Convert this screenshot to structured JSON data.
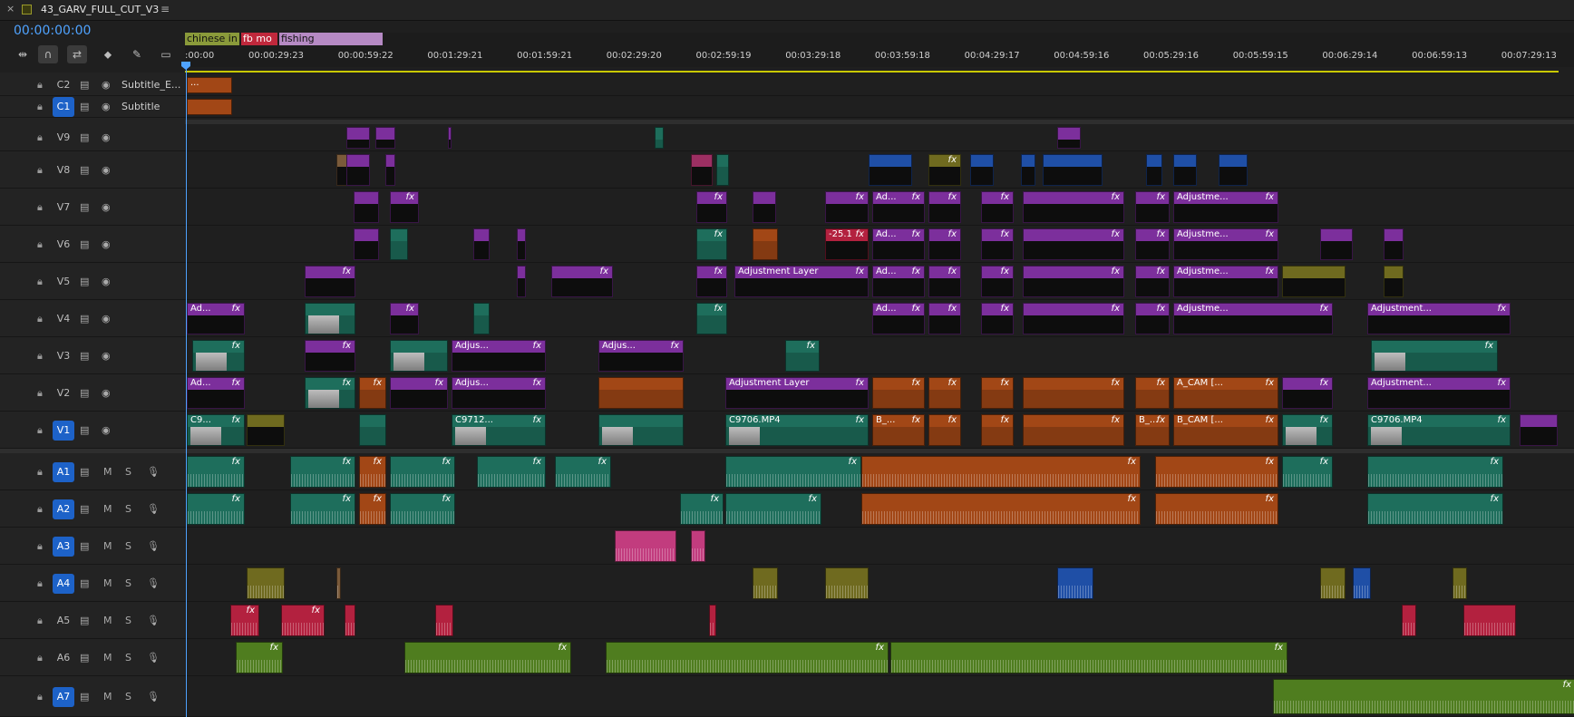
{
  "window": {
    "title": "43_GARV_FULL_CUT_V3",
    "close_icon": "close-icon",
    "menu_icon": "hamburger-menu-icon"
  },
  "timecode": "00:00:00:00",
  "tools": [
    "insert-overwrite-icon",
    "snap-magnet-icon",
    "linked-selection-icon",
    "add-marker-icon",
    "wrench-settings-icon",
    "captions-icon"
  ],
  "markers": [
    {
      "label": "chinese in",
      "color": "#8a9a3a"
    },
    {
      "label": "fb mo",
      "color": "#c0283c"
    },
    {
      "label": "fishing",
      "color": "#b68ac4"
    }
  ],
  "ruler_ticks": [
    ":00:00",
    "00:00:29:23",
    "00:00:59:22",
    "00:01:29:21",
    "00:01:59:21",
    "00:02:29:20",
    "00:02:59:19",
    "00:03:29:18",
    "00:03:59:18",
    "00:04:29:17",
    "00:04:59:16",
    "00:05:29:16",
    "00:05:59:15",
    "00:06:29:14",
    "00:06:59:13",
    "00:07:29:13"
  ],
  "subtitle_tracks": [
    {
      "name": "C2",
      "label": "Subtitle_E...",
      "active": false
    },
    {
      "name": "C1",
      "label": "Subtitle",
      "active": true
    }
  ],
  "video_tracks": [
    {
      "name": "V9",
      "active": false
    },
    {
      "name": "V8",
      "active": false
    },
    {
      "name": "V7",
      "active": false
    },
    {
      "name": "V6",
      "active": false
    },
    {
      "name": "V5",
      "active": false
    },
    {
      "name": "V4",
      "active": false
    },
    {
      "name": "V3",
      "active": false
    },
    {
      "name": "V2",
      "active": false
    },
    {
      "name": "V1",
      "active": true
    }
  ],
  "audio_tracks": [
    {
      "name": "A1",
      "active": true,
      "m": "M",
      "s": "S"
    },
    {
      "name": "A2",
      "active": true,
      "m": "M",
      "s": "S"
    },
    {
      "name": "A3",
      "active": true,
      "m": "M",
      "s": "S"
    },
    {
      "name": "A4",
      "active": true,
      "m": "M",
      "s": "S"
    },
    {
      "name": "A5",
      "active": false,
      "m": "M",
      "s": "S"
    },
    {
      "name": "A6",
      "active": false,
      "m": "M",
      "s": "S"
    },
    {
      "name": "A7",
      "active": true,
      "m": "M",
      "s": "S"
    }
  ],
  "clips": {
    "C2": [
      {
        "c": "orange",
        "s": 0,
        "e": 50,
        "l": "..."
      }
    ],
    "C1": [
      {
        "c": "orange",
        "s": 0,
        "e": 50,
        "l": ""
      }
    ],
    "V9": [
      {
        "c": "purple",
        "s": 176,
        "e": 202,
        "l": ""
      },
      {
        "c": "purple",
        "s": 208,
        "e": 230,
        "l": ""
      },
      {
        "c": "purple",
        "s": 288,
        "e": 292,
        "l": ""
      },
      {
        "c": "teal",
        "s": 516,
        "e": 526,
        "l": ""
      },
      {
        "c": "purple",
        "s": 960,
        "e": 986,
        "l": ""
      }
    ],
    "V8": [
      {
        "c": "tan",
        "s": 165,
        "e": 180,
        "l": ""
      },
      {
        "c": "purple",
        "s": 176,
        "e": 202,
        "l": ""
      },
      {
        "c": "purple",
        "s": 219,
        "e": 230,
        "l": ""
      },
      {
        "c": "magenta",
        "s": 556,
        "e": 580,
        "l": ""
      },
      {
        "c": "teal",
        "s": 584,
        "e": 598,
        "l": ""
      },
      {
        "c": "blue",
        "s": 752,
        "e": 800,
        "l": ""
      },
      {
        "c": "olive",
        "s": 818,
        "e": 854,
        "l": "fx"
      },
      {
        "c": "blue",
        "s": 864,
        "e": 890,
        "l": ""
      },
      {
        "c": "blue",
        "s": 920,
        "e": 936,
        "l": ""
      },
      {
        "c": "blue",
        "s": 944,
        "e": 1010,
        "l": ""
      },
      {
        "c": "blue",
        "s": 1058,
        "e": 1076,
        "l": ""
      },
      {
        "c": "blue",
        "s": 1088,
        "e": 1114,
        "l": ""
      },
      {
        "c": "blue",
        "s": 1138,
        "e": 1170,
        "l": ""
      }
    ],
    "V7": [
      {
        "c": "purple",
        "s": 184,
        "e": 212,
        "l": ""
      },
      {
        "c": "purple",
        "s": 224,
        "e": 256,
        "l": "fx"
      },
      {
        "c": "purple",
        "s": 562,
        "e": 596,
        "l": "fx"
      },
      {
        "c": "purple",
        "s": 624,
        "e": 650,
        "l": ""
      },
      {
        "c": "purple",
        "s": 704,
        "e": 752,
        "l": "fx"
      },
      {
        "c": "purple",
        "s": 756,
        "e": 814,
        "l": "Ad..."
      },
      {
        "c": "purple",
        "s": 818,
        "e": 854,
        "l": "fx"
      },
      {
        "c": "purple",
        "s": 876,
        "e": 912,
        "l": "fx"
      },
      {
        "c": "purple",
        "s": 922,
        "e": 1034,
        "l": "fx"
      },
      {
        "c": "purple",
        "s": 1046,
        "e": 1084,
        "l": "fx"
      },
      {
        "c": "purple",
        "s": 1088,
        "e": 1204,
        "l": "Adjustme..."
      }
    ],
    "V6": [
      {
        "c": "purple",
        "s": 184,
        "e": 212,
        "l": ""
      },
      {
        "c": "teal",
        "s": 224,
        "e": 244,
        "l": ""
      },
      {
        "c": "purple",
        "s": 316,
        "e": 334,
        "l": ""
      },
      {
        "c": "purple",
        "s": 364,
        "e": 374,
        "l": ""
      },
      {
        "c": "teal",
        "s": 562,
        "e": 596,
        "l": "fx"
      },
      {
        "c": "orange",
        "s": 624,
        "e": 652,
        "l": ""
      },
      {
        "c": "red",
        "s": 704,
        "e": 752,
        "l": "-25.1"
      },
      {
        "c": "purple",
        "s": 756,
        "e": 814,
        "l": "Ad..."
      },
      {
        "c": "purple",
        "s": 818,
        "e": 854,
        "l": "fx"
      },
      {
        "c": "purple",
        "s": 876,
        "e": 912,
        "l": "fx"
      },
      {
        "c": "purple",
        "s": 922,
        "e": 1034,
        "l": "fx"
      },
      {
        "c": "purple",
        "s": 1046,
        "e": 1084,
        "l": "fx"
      },
      {
        "c": "purple",
        "s": 1088,
        "e": 1204,
        "l": "Adjustme..."
      },
      {
        "c": "purple",
        "s": 1250,
        "e": 1286,
        "l": ""
      },
      {
        "c": "purple",
        "s": 1320,
        "e": 1342,
        "l": ""
      }
    ],
    "V5": [
      {
        "c": "purple",
        "s": 130,
        "e": 186,
        "l": "fx"
      },
      {
        "c": "purple",
        "s": 364,
        "e": 374,
        "l": ""
      },
      {
        "c": "purple",
        "s": 402,
        "e": 470,
        "l": "fx"
      },
      {
        "c": "purple",
        "s": 562,
        "e": 596,
        "l": "fx"
      },
      {
        "c": "purple",
        "s": 604,
        "e": 752,
        "l": "Adjustment Layer"
      },
      {
        "c": "purple",
        "s": 756,
        "e": 814,
        "l": "Ad..."
      },
      {
        "c": "purple",
        "s": 818,
        "e": 854,
        "l": "fx"
      },
      {
        "c": "purple",
        "s": 876,
        "e": 912,
        "l": "fx"
      },
      {
        "c": "purple",
        "s": 922,
        "e": 1034,
        "l": "fx"
      },
      {
        "c": "purple",
        "s": 1046,
        "e": 1084,
        "l": "fx"
      },
      {
        "c": "purple",
        "s": 1088,
        "e": 1204,
        "l": "Adjustme..."
      },
      {
        "c": "olive",
        "s": 1208,
        "e": 1278,
        "l": ""
      },
      {
        "c": "olive",
        "s": 1320,
        "e": 1342,
        "l": ""
      }
    ],
    "V4": [
      {
        "c": "purple",
        "s": 0,
        "e": 64,
        "l": "Ad..."
      },
      {
        "c": "teal",
        "s": 130,
        "e": 186,
        "l": ""
      },
      {
        "c": "purple",
        "s": 224,
        "e": 256,
        "l": "fx"
      },
      {
        "c": "teal",
        "s": 316,
        "e": 334,
        "l": ""
      },
      {
        "c": "teal",
        "s": 562,
        "e": 596,
        "l": "fx"
      },
      {
        "c": "purple",
        "s": 756,
        "e": 814,
        "l": "Ad..."
      },
      {
        "c": "purple",
        "s": 818,
        "e": 854,
        "l": "fx"
      },
      {
        "c": "purple",
        "s": 876,
        "e": 912,
        "l": "fx"
      },
      {
        "c": "purple",
        "s": 922,
        "e": 1034,
        "l": "fx"
      },
      {
        "c": "purple",
        "s": 1046,
        "e": 1084,
        "l": "fx"
      },
      {
        "c": "purple",
        "s": 1088,
        "e": 1264,
        "l": "Adjustme..."
      },
      {
        "c": "purple",
        "s": 1302,
        "e": 1460,
        "l": "Adjustment..."
      }
    ],
    "V3": [
      {
        "c": "teal",
        "s": 6,
        "e": 64,
        "l": "fx"
      },
      {
        "c": "purple",
        "s": 130,
        "e": 186,
        "l": "fx"
      },
      {
        "c": "teal",
        "s": 224,
        "e": 288,
        "l": ""
      },
      {
        "c": "purple",
        "s": 292,
        "e": 396,
        "l": "Adjus..."
      },
      {
        "c": "purple",
        "s": 454,
        "e": 548,
        "l": "Adjus..."
      },
      {
        "c": "teal",
        "s": 660,
        "e": 698,
        "l": "fx"
      },
      {
        "c": "teal",
        "s": 1306,
        "e": 1446,
        "l": "fx"
      }
    ],
    "V2": [
      {
        "c": "purple",
        "s": 0,
        "e": 64,
        "l": "Ad..."
      },
      {
        "c": "teal",
        "s": 130,
        "e": 186,
        "l": "fx"
      },
      {
        "c": "orange",
        "s": 190,
        "e": 220,
        "l": "fx"
      },
      {
        "c": "purple",
        "s": 224,
        "e": 288,
        "l": "fx"
      },
      {
        "c": "purple",
        "s": 292,
        "e": 396,
        "l": "Adjus..."
      },
      {
        "c": "orange",
        "s": 454,
        "e": 548,
        "l": ""
      },
      {
        "c": "purple",
        "s": 594,
        "e": 752,
        "l": "Adjustment Layer"
      },
      {
        "c": "orange",
        "s": 756,
        "e": 814,
        "l": "fx"
      },
      {
        "c": "orange",
        "s": 818,
        "e": 854,
        "l": "fx"
      },
      {
        "c": "orange",
        "s": 876,
        "e": 912,
        "l": "fx"
      },
      {
        "c": "orange",
        "s": 922,
        "e": 1034,
        "l": "fx"
      },
      {
        "c": "orange",
        "s": 1046,
        "e": 1084,
        "l": "fx"
      },
      {
        "c": "orange",
        "s": 1088,
        "e": 1204,
        "l": "A_CAM [..."
      },
      {
        "c": "purple",
        "s": 1208,
        "e": 1264,
        "l": "fx"
      },
      {
        "c": "purple",
        "s": 1302,
        "e": 1460,
        "l": "Adjustment..."
      }
    ],
    "V1": [
      {
        "c": "teal",
        "s": 0,
        "e": 64,
        "l": "C9..."
      },
      {
        "c": "olive",
        "s": 66,
        "e": 108,
        "l": ""
      },
      {
        "c": "teal",
        "s": 190,
        "e": 220,
        "l": ""
      },
      {
        "c": "teal",
        "s": 292,
        "e": 396,
        "l": "C9712..."
      },
      {
        "c": "teal",
        "s": 454,
        "e": 548,
        "l": ""
      },
      {
        "c": "teal",
        "s": 594,
        "e": 752,
        "l": "C9706.MP4"
      },
      {
        "c": "orange",
        "s": 756,
        "e": 814,
        "l": "B_..."
      },
      {
        "c": "orange",
        "s": 818,
        "e": 854,
        "l": "fx"
      },
      {
        "c": "orange",
        "s": 876,
        "e": 912,
        "l": "fx"
      },
      {
        "c": "orange",
        "s": 922,
        "e": 1034,
        "l": "fx"
      },
      {
        "c": "orange",
        "s": 1046,
        "e": 1084,
        "l": "B_..."
      },
      {
        "c": "orange",
        "s": 1088,
        "e": 1204,
        "l": "B_CAM [..."
      },
      {
        "c": "teal",
        "s": 1208,
        "e": 1264,
        "l": "fx"
      },
      {
        "c": "teal",
        "s": 1302,
        "e": 1460,
        "l": "C9706.MP4"
      },
      {
        "c": "purple",
        "s": 1470,
        "e": 1512,
        "l": ""
      }
    ],
    "A1": [
      {
        "c": "teal",
        "s": 0,
        "e": 64,
        "l": "fx"
      },
      {
        "c": "teal",
        "s": 114,
        "e": 186,
        "l": "fx"
      },
      {
        "c": "orange",
        "s": 190,
        "e": 220,
        "l": "fx"
      },
      {
        "c": "teal",
        "s": 224,
        "e": 296,
        "l": "fx"
      },
      {
        "c": "teal",
        "s": 320,
        "e": 396,
        "l": "fx"
      },
      {
        "c": "teal",
        "s": 406,
        "e": 468,
        "l": "fx"
      },
      {
        "c": "teal",
        "s": 594,
        "e": 744,
        "l": "fx"
      },
      {
        "c": "orange",
        "s": 744,
        "e": 1052,
        "l": "fx"
      },
      {
        "c": "orange",
        "s": 1068,
        "e": 1204,
        "l": "fx"
      },
      {
        "c": "teal",
        "s": 1208,
        "e": 1264,
        "l": "fx"
      },
      {
        "c": "teal",
        "s": 1302,
        "e": 1452,
        "l": "fx"
      }
    ],
    "A2": [
      {
        "c": "teal",
        "s": 0,
        "e": 64,
        "l": "fx"
      },
      {
        "c": "teal",
        "s": 114,
        "e": 186,
        "l": "fx"
      },
      {
        "c": "orange",
        "s": 190,
        "e": 220,
        "l": "fx"
      },
      {
        "c": "teal",
        "s": 224,
        "e": 296,
        "l": "fx"
      },
      {
        "c": "teal",
        "s": 544,
        "e": 592,
        "l": "fx"
      },
      {
        "c": "teal",
        "s": 594,
        "e": 700,
        "l": "fx"
      },
      {
        "c": "orange",
        "s": 744,
        "e": 1052,
        "l": "fx"
      },
      {
        "c": "orange",
        "s": 1068,
        "e": 1204,
        "l": "fx"
      },
      {
        "c": "teal",
        "s": 1302,
        "e": 1452,
        "l": "fx"
      }
    ],
    "A3": [
      {
        "c": "pink",
        "s": 472,
        "e": 540,
        "l": ""
      },
      {
        "c": "pink",
        "s": 556,
        "e": 572,
        "l": ""
      }
    ],
    "A4": [
      {
        "c": "olive",
        "s": 66,
        "e": 108,
        "l": ""
      },
      {
        "c": "tan",
        "s": 165,
        "e": 170,
        "l": ""
      },
      {
        "c": "olive",
        "s": 624,
        "e": 652,
        "l": ""
      },
      {
        "c": "olive",
        "s": 704,
        "e": 752,
        "l": ""
      },
      {
        "c": "blue",
        "s": 960,
        "e": 1000,
        "l": ""
      },
      {
        "c": "olive",
        "s": 1250,
        "e": 1278,
        "l": ""
      },
      {
        "c": "blue",
        "s": 1286,
        "e": 1306,
        "l": ""
      },
      {
        "c": "olive",
        "s": 1396,
        "e": 1412,
        "l": ""
      }
    ],
    "A5": [
      {
        "c": "red",
        "s": 48,
        "e": 80,
        "l": "fx"
      },
      {
        "c": "red",
        "s": 104,
        "e": 152,
        "l": "fx"
      },
      {
        "c": "red",
        "s": 174,
        "e": 186,
        "l": ""
      },
      {
        "c": "red",
        "s": 274,
        "e": 294,
        "l": ""
      },
      {
        "c": "red",
        "s": 576,
        "e": 584,
        "l": ""
      },
      {
        "c": "red",
        "s": 1340,
        "e": 1356,
        "l": ""
      },
      {
        "c": "red",
        "s": 1408,
        "e": 1466,
        "l": ""
      }
    ],
    "A6": [
      {
        "c": "green",
        "s": 54,
        "e": 106,
        "l": "fx"
      },
      {
        "c": "green",
        "s": 240,
        "e": 424,
        "l": "fx"
      },
      {
        "c": "green",
        "s": 462,
        "e": 774,
        "l": "fx"
      },
      {
        "c": "green",
        "s": 776,
        "e": 1214,
        "l": "fx"
      }
    ],
    "A7": [
      {
        "c": "green",
        "s": 1198,
        "e": 1532,
        "l": "fx"
      }
    ]
  }
}
